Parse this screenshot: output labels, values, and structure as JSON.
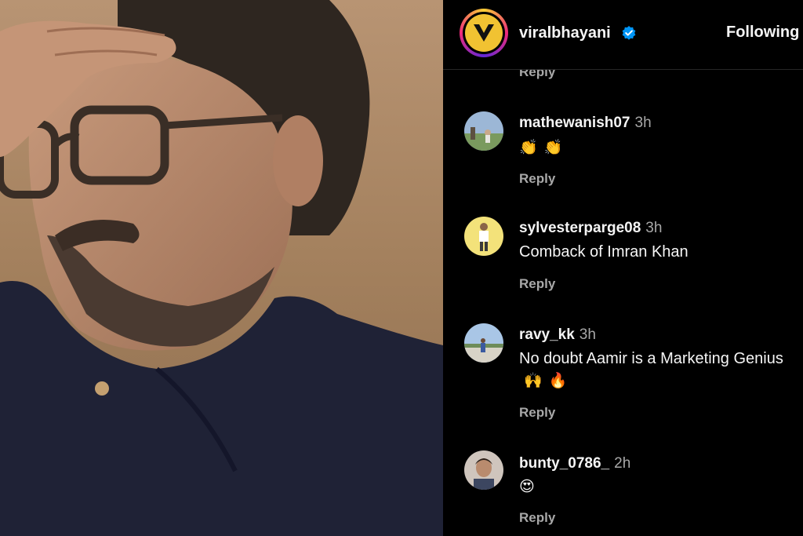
{
  "header": {
    "username": "viralbhayani",
    "follow_label": "Following",
    "avatar_letter": "V"
  },
  "partial_reply_label": "Reply",
  "comments": [
    {
      "username": "mathewanish07",
      "time": "3h",
      "text": "",
      "emojis": [
        "👏",
        "👏"
      ],
      "reply_label": "Reply"
    },
    {
      "username": "sylvesterparge08",
      "time": "3h",
      "text": "Comback of Imran Khan",
      "emojis": [],
      "reply_label": "Reply"
    },
    {
      "username": "ravy_kk",
      "time": "3h",
      "text": "No doubt Aamir is a Marketing Genius",
      "emojis": [
        "🙌",
        "🔥"
      ],
      "reply_label": "Reply"
    },
    {
      "username": "bunty_0786_",
      "time": "2h",
      "text": "",
      "emojis": [
        "😍"
      ],
      "reply_label": "Reply"
    }
  ],
  "colors": {
    "background": "#000000",
    "secondary_text": "#a8a8a8",
    "verified_blue": "#0095f6",
    "brand_yellow": "#f1c232"
  }
}
